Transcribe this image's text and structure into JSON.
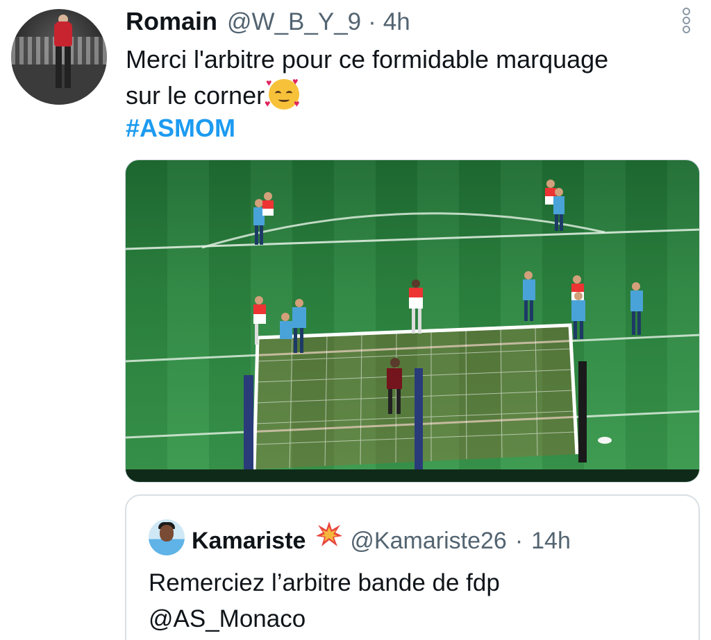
{
  "tweet": {
    "author_name": "Romain",
    "author_handle": "@W_B_Y_9",
    "separator": "·",
    "time": "4h",
    "text_line1": "Merci l'arbitre pour ce formidable marquage",
    "text_line2": "sur le corner",
    "hashtag": "#ASMOM"
  },
  "quoted_tweet": {
    "author_name": "Kamariste",
    "author_handle": "@Kamariste26",
    "separator": "·",
    "time": "14h",
    "text_line1": "Remerciez l’arbitre bande de fdp",
    "text_line2": "@AS_Monaco"
  },
  "icons": {
    "more": "more-vertical-icon",
    "emoji": "smiling-face-with-hearts-icon",
    "badge": "collision-icon"
  },
  "colors": {
    "link": "#1d9bf0",
    "muted": "#536471",
    "text": "#0f1419"
  }
}
